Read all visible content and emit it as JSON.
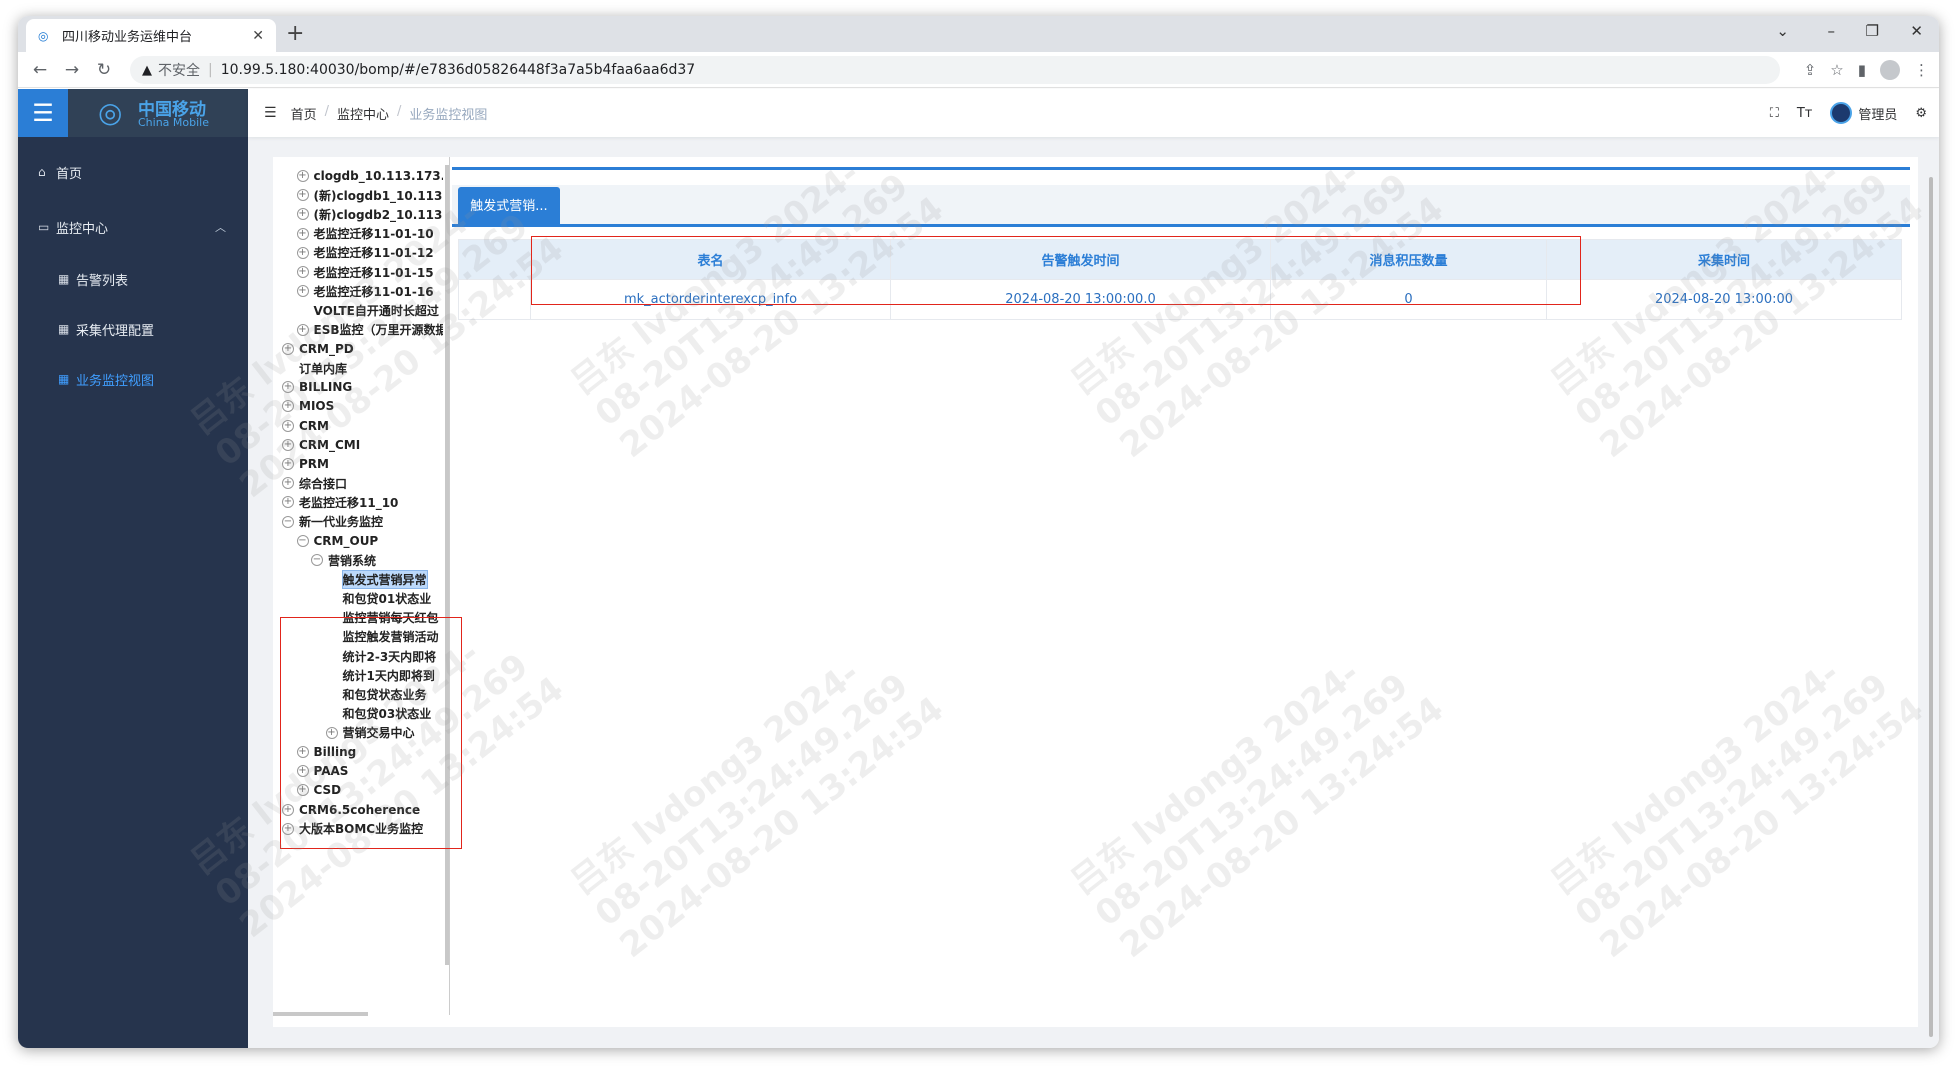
{
  "browser": {
    "tab_title": "四川移动业务运维中台",
    "tab_close": "✕",
    "new_tab": "+",
    "insecure_label": "不安全",
    "url": "10.99.5.180:40030/bomp/#/e7836d05826448f3a7a5b4faa6aa6d37",
    "window_controls": [
      "⌄",
      "–",
      "❐",
      "✕"
    ]
  },
  "sidebar": {
    "logo_cn": "中国移动",
    "logo_en": "China Mobile",
    "items": [
      {
        "label": "首页",
        "icon": "home-icon"
      },
      {
        "label": "监控中心",
        "icon": "monitor-icon"
      },
      {
        "label": "告警列表",
        "icon": "grid-icon"
      },
      {
        "label": "采集代理配置",
        "icon": "grid-icon"
      },
      {
        "label": "业务监控视图",
        "icon": "grid-icon"
      }
    ]
  },
  "header": {
    "breadcrumbs": [
      "首页",
      "监控中心",
      "业务监控视图"
    ],
    "user": "管理员",
    "font_btn": "Tт"
  },
  "tree": {
    "nodes": [
      {
        "label": "clogdb_10.113.173.1",
        "toggle": "+"
      },
      {
        "label": "(新)clogdb1_10.113.1",
        "toggle": "+"
      },
      {
        "label": "(新)clogdb2_10.113.1",
        "toggle": "+"
      },
      {
        "label": "老监控迁移11-01-10",
        "toggle": "+"
      },
      {
        "label": "老监控迁移11-01-12",
        "toggle": "+"
      },
      {
        "label": "老监控迁移11-01-15",
        "toggle": "+"
      },
      {
        "label": "老监控迁移11-01-16",
        "toggle": "+"
      },
      {
        "label": "VOLTE自开通时长超过",
        "toggle": ""
      },
      {
        "label": "ESB监控（万里开源数据",
        "toggle": "+"
      },
      {
        "label": "CRM_PD",
        "toggle": "+"
      },
      {
        "label": "订单内库",
        "toggle": ""
      },
      {
        "label": "BILLING",
        "toggle": "+"
      },
      {
        "label": "MIOS",
        "toggle": "+"
      },
      {
        "label": "CRM",
        "toggle": "+"
      },
      {
        "label": "CRM_CMI",
        "toggle": "+"
      },
      {
        "label": "PRM",
        "toggle": "+"
      },
      {
        "label": "综合接口",
        "toggle": "+"
      },
      {
        "label": "老监控迁移11_10",
        "toggle": "+"
      },
      {
        "label": "新一代业务监控",
        "toggle": "−"
      },
      {
        "label": "CRM_OUP",
        "toggle": "−"
      },
      {
        "label": "营销系统",
        "toggle": "−"
      },
      {
        "label": "触发式营销异常",
        "toggle": ""
      },
      {
        "label": "和包贷01状态业",
        "toggle": ""
      },
      {
        "label": "监控营销每天红包",
        "toggle": ""
      },
      {
        "label": "监控触发营销活动",
        "toggle": ""
      },
      {
        "label": "统计2-3天内即将",
        "toggle": ""
      },
      {
        "label": "统计1天内即将到",
        "toggle": ""
      },
      {
        "label": "和包贷状态业务",
        "toggle": ""
      },
      {
        "label": "和包贷03状态业",
        "toggle": ""
      },
      {
        "label": "营销交易中心",
        "toggle": "+"
      },
      {
        "label": "Billing",
        "toggle": "+"
      },
      {
        "label": "PAAS",
        "toggle": "+"
      },
      {
        "label": "CSD",
        "toggle": "+"
      },
      {
        "label": "CRM6.5coherence",
        "toggle": "+"
      },
      {
        "label": "大版本BOMC业务监控",
        "toggle": "+"
      }
    ]
  },
  "panel": {
    "tab_label": "触发式营销...",
    "columns": [
      "表名",
      "告警触发时间",
      "消息积压数量",
      "采集时间"
    ],
    "rows": [
      [
        "mk_actorderinterexcp_info",
        "2024-08-20 13:00:00.0",
        "0",
        "2024-08-20 13:00:00"
      ]
    ]
  },
  "watermark": {
    "line1": "吕东 lvdong3 2024-",
    "line2": "08-20T13:24:49.269",
    "line3": "2024-08-20 13:24:54"
  },
  "colors": {
    "accent": "#2b7ed6",
    "sidebar_bg": "#26344d",
    "highlight_box": "#e1251b"
  }
}
